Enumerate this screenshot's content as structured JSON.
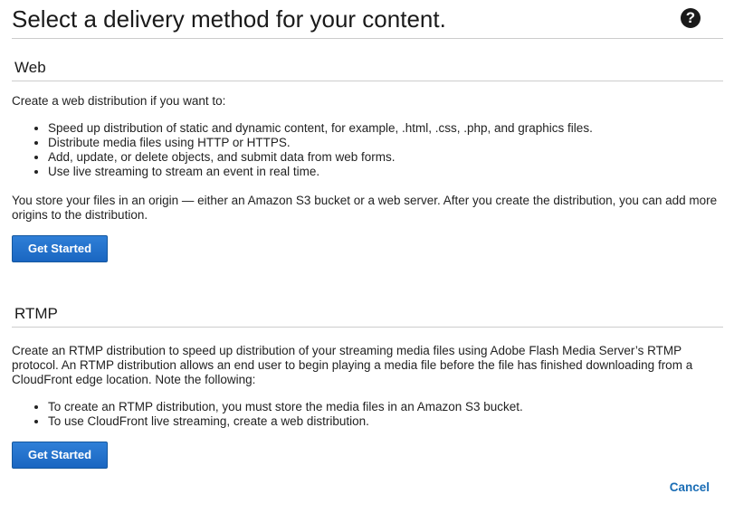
{
  "header": {
    "title": "Select a delivery method for your content.",
    "help_icon_glyph": "?"
  },
  "web": {
    "title": "Web",
    "intro": "Create a web distribution if you want to:",
    "bullets": [
      "Speed up distribution of static and dynamic content, for example, .html, .css, .php, and graphics files.",
      "Distribute media files using HTTP or HTTPS.",
      "Add, update, or delete objects, and submit data from web forms.",
      "Use live streaming to stream an event in real time."
    ],
    "origin_text": "You store your files in an origin — either an Amazon S3 bucket or a web server. After you create the distribution, you can add more origins to the distribution.",
    "button_label": "Get Started"
  },
  "rtmp": {
    "title": "RTMP",
    "intro": "Create an RTMP distribution to speed up distribution of your streaming media files using Adobe Flash Media Server’s RTMP protocol. An RTMP distribution allows an end user to begin playing a media file before the file has finished downloading from a CloudFront edge location. Note the following:",
    "bullets": [
      "To create an RTMP distribution, you must store the media files in an Amazon S3 bucket.",
      "To use CloudFront live streaming, create a web distribution."
    ],
    "button_label": "Get Started"
  },
  "footer": {
    "cancel_label": "Cancel"
  },
  "colors": {
    "accent_button": "#1a66c1",
    "link": "#1a6db5",
    "divider": "#cccccc"
  }
}
